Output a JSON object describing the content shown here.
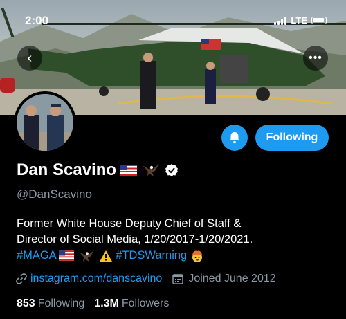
{
  "status_bar": {
    "time": "2:00",
    "network": "LTE"
  },
  "banner": {
    "icons": {
      "back": "chevron-left-icon",
      "more": "ellipsis-icon"
    }
  },
  "actions": {
    "notify_icon": "bell-icon",
    "follow_label": "Following"
  },
  "profile": {
    "name": "Dan Scavino",
    "handle": "@DanScavino",
    "verified": true,
    "bio": {
      "line1": "Former White House Deputy Chief of Staff &",
      "line2": "Director of Social Media, 1/20/2017-1/20/2021.",
      "hashtag1": "#MAGA",
      "hashtag2": "#TDSWarning"
    },
    "link": "instagram.com/danscavino",
    "joined": "Joined June 2012",
    "following_count": "853",
    "following_label": "Following",
    "followers_count": "1.3M",
    "followers_label": "Followers"
  },
  "colors": {
    "accent": "#1d9bf0",
    "muted": "#8b98a5",
    "background": "#000000"
  }
}
